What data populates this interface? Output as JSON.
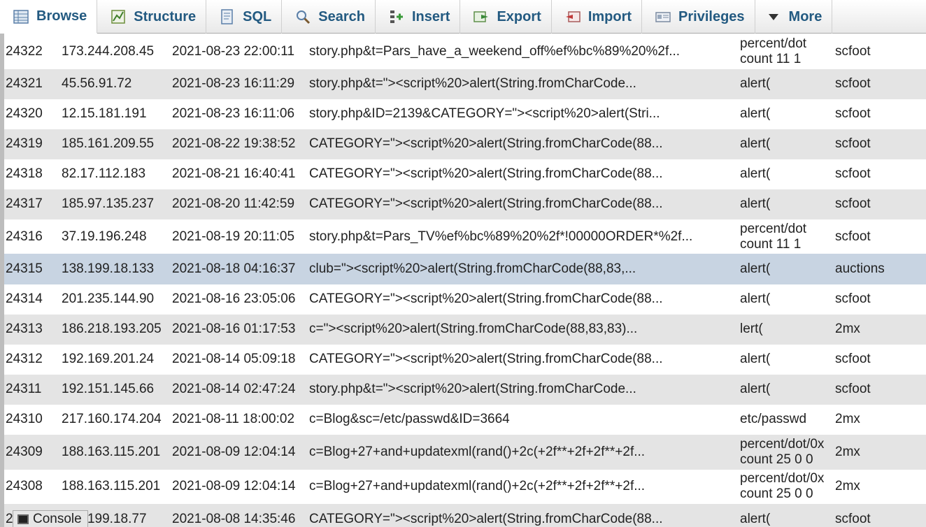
{
  "tabs": [
    {
      "label": "Browse",
      "icon": "browse-icon"
    },
    {
      "label": "Structure",
      "icon": "structure-icon"
    },
    {
      "label": "SQL",
      "icon": "sql-icon"
    },
    {
      "label": "Search",
      "icon": "search-icon"
    },
    {
      "label": "Insert",
      "icon": "insert-icon"
    },
    {
      "label": "Export",
      "icon": "export-icon"
    },
    {
      "label": "Import",
      "icon": "import-icon"
    },
    {
      "label": "Privileges",
      "icon": "privileges-icon"
    },
    {
      "label": "More",
      "icon": "chevron-down-icon"
    }
  ],
  "rows": [
    {
      "id": "24322",
      "ip": "173.244.208.45",
      "datetime": "2021-08-23 22:00:11",
      "url": "story.php&t=Pars_have_a_weekend_off%ef%bc%89%20%2f...",
      "value": "percent/dot count 11 1",
      "site": "scfoot"
    },
    {
      "id": "24321",
      "ip": "45.56.91.72",
      "datetime": "2021-08-23 16:11:29",
      "url": "story.php&t=\"><script%20>alert(String.fromCharCode...",
      "value": "alert(",
      "site": "scfoot"
    },
    {
      "id": "24320",
      "ip": "12.15.181.191",
      "datetime": "2021-08-23 16:11:06",
      "url": "story.php&ID=2139&CATEGORY=\"><script%20>alert(Stri...",
      "value": "alert(",
      "site": "scfoot"
    },
    {
      "id": "24319",
      "ip": "185.161.209.55",
      "datetime": "2021-08-22 19:38:52",
      "url": "CATEGORY=\"><script%20>alert(String.fromCharCode(88...",
      "value": "alert(",
      "site": "scfoot"
    },
    {
      "id": "24318",
      "ip": "82.17.112.183",
      "datetime": "2021-08-21 16:40:41",
      "url": "CATEGORY=\"><script%20>alert(String.fromCharCode(88...",
      "value": "alert(",
      "site": "scfoot"
    },
    {
      "id": "24317",
      "ip": "185.97.135.237",
      "datetime": "2021-08-20 11:42:59",
      "url": "CATEGORY=\"><script%20>alert(String.fromCharCode(88...",
      "value": "alert(",
      "site": "scfoot"
    },
    {
      "id": "24316",
      "ip": "37.19.196.248",
      "datetime": "2021-08-19 20:11:05",
      "url": "story.php&t=Pars_TV%ef%bc%89%20%2f*!00000ORDER*%2f...",
      "value": "percent/dot count 11 1",
      "site": "scfoot"
    },
    {
      "id": "24315",
      "ip": "138.199.18.133",
      "datetime": "2021-08-18 04:16:37",
      "url": "club=\"><script%20>alert(String.fromCharCode(88,83,...",
      "value": "alert(",
      "site": "auctions"
    },
    {
      "id": "24314",
      "ip": "201.235.144.90",
      "datetime": "2021-08-16 23:05:06",
      "url": "CATEGORY=\"><script%20>alert(String.fromCharCode(88...",
      "value": "alert(",
      "site": "scfoot"
    },
    {
      "id": "24313",
      "ip": "186.218.193.205",
      "datetime": "2021-08-16 01:17:53",
      "url": "c=\"><script%20>alert(String.fromCharCode(88,83,83)...",
      "value": "lert(",
      "site": "2mx"
    },
    {
      "id": "24312",
      "ip": "192.169.201.24",
      "datetime": "2021-08-14 05:09:18",
      "url": "CATEGORY=\"><script%20>alert(String.fromCharCode(88...",
      "value": "alert(",
      "site": "scfoot"
    },
    {
      "id": "24311",
      "ip": "192.151.145.66",
      "datetime": "2021-08-14 02:47:24",
      "url": "story.php&t=\"><script%20>alert(String.fromCharCode...",
      "value": "alert(",
      "site": "scfoot"
    },
    {
      "id": "24310",
      "ip": "217.160.174.204",
      "datetime": "2021-08-11 18:00:02",
      "url": "c=Blog&sc=/etc/passwd&ID=3664",
      "value": "etc/passwd",
      "site": "2mx"
    },
    {
      "id": "24309",
      "ip": "188.163.115.201",
      "datetime": "2021-08-09 12:04:14",
      "url": "c=Blog+27+and+updatexml(rand()+2c(+2f**+2f+2f**+2f...",
      "value": "percent/dot/0x count 25 0 0",
      "site": "2mx"
    },
    {
      "id": "24308",
      "ip": "188.163.115.201",
      "datetime": "2021-08-09 12:04:14",
      "url": "c=Blog+27+and+updatexml(rand()+2c(+2f**+2f+2f**+2f...",
      "value": "percent/dot/0x count 25 0 0",
      "site": "2mx"
    },
    {
      "id": "24307",
      "ip": "138.199.18.77",
      "datetime": "2021-08-08 14:35:46",
      "url": "CATEGORY=\"><script%20>alert(String.fromCharCode(88...",
      "value": "alert(",
      "site": "scfoot"
    }
  ],
  "console": {
    "label": "Console",
    "icon": "console-icon"
  }
}
